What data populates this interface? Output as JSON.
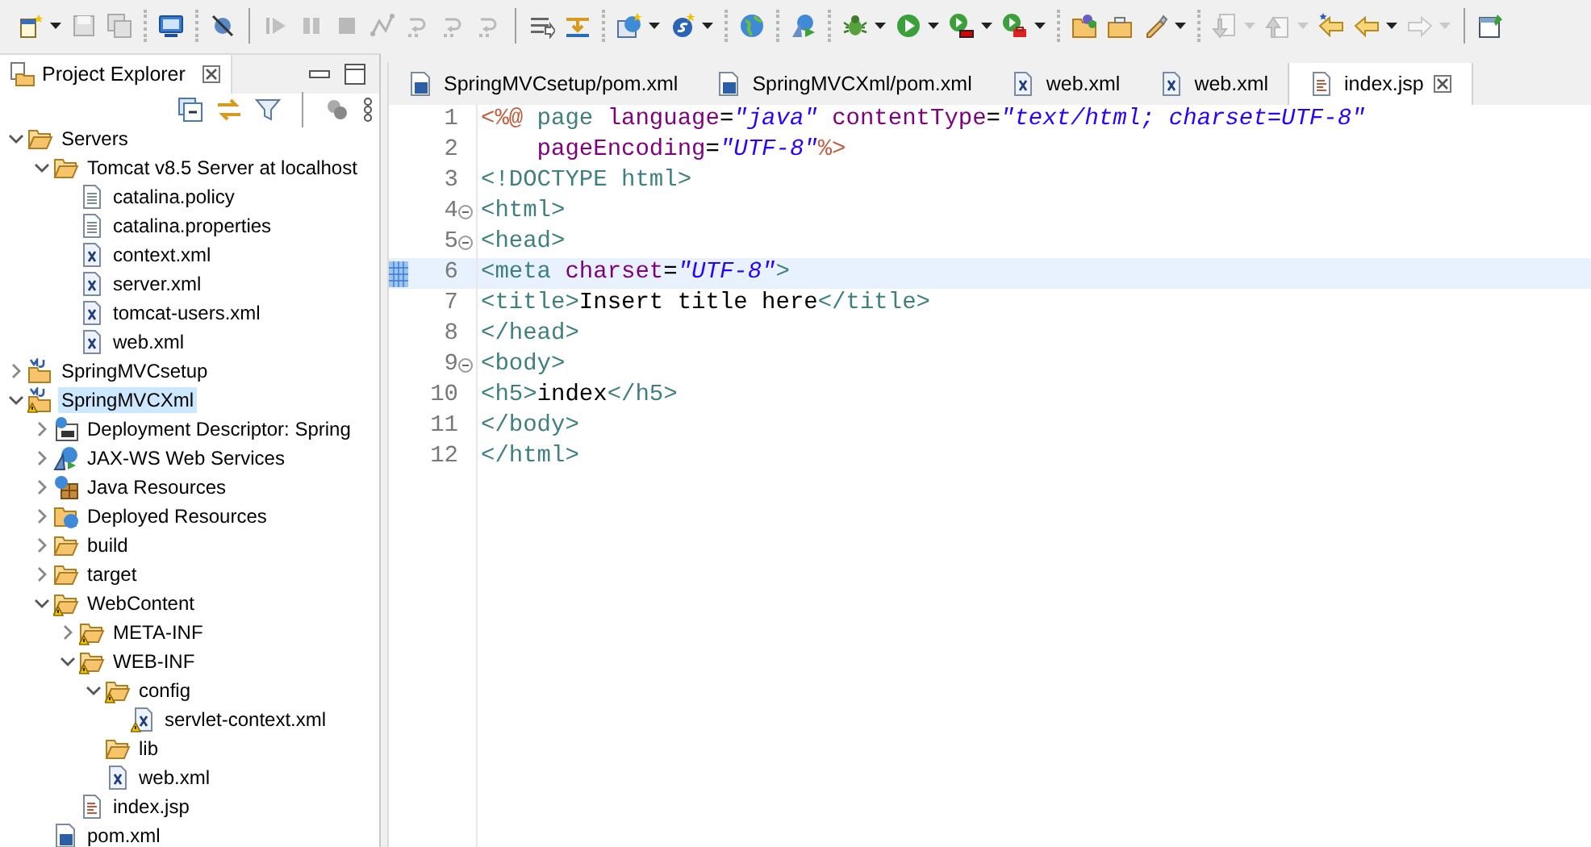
{
  "toolbar": [
    {
      "kind": "new",
      "disabled": false,
      "dropdown": true
    },
    {
      "kind": "save",
      "disabled": true,
      "dropdown": false
    },
    {
      "kind": "save-all",
      "disabled": true,
      "dropdown": false
    },
    {
      "kind": "grip"
    },
    {
      "kind": "monitor",
      "disabled": false,
      "dropdown": false
    },
    {
      "kind": "grip"
    },
    {
      "kind": "skip",
      "disabled": false,
      "dropdown": false
    },
    {
      "kind": "separator"
    },
    {
      "kind": "resume",
      "disabled": true,
      "dropdown": false
    },
    {
      "kind": "suspend",
      "disabled": true,
      "dropdown": false
    },
    {
      "kind": "stop",
      "disabled": true,
      "dropdown": false
    },
    {
      "kind": "disconnect",
      "disabled": true,
      "dropdown": false
    },
    {
      "kind": "step",
      "disabled": true,
      "dropdown": false
    },
    {
      "kind": "step",
      "disabled": true,
      "dropdown": false
    },
    {
      "kind": "step",
      "disabled": true,
      "dropdown": false
    },
    {
      "kind": "separator"
    },
    {
      "kind": "filter-lines",
      "disabled": false,
      "dropdown": false
    },
    {
      "kind": "drop-frame",
      "disabled": false,
      "dropdown": false
    },
    {
      "kind": "grip"
    },
    {
      "kind": "server",
      "disabled": false,
      "dropdown": true
    },
    {
      "kind": "spring",
      "disabled": false,
      "dropdown": true
    },
    {
      "kind": "grip"
    },
    {
      "kind": "globe",
      "disabled": false,
      "dropdown": false
    },
    {
      "kind": "grip"
    },
    {
      "kind": "web-service",
      "disabled": false,
      "dropdown": false
    },
    {
      "kind": "grip"
    },
    {
      "kind": "debug",
      "disabled": false,
      "dropdown": true
    },
    {
      "kind": "run",
      "disabled": false,
      "dropdown": true
    },
    {
      "kind": "run-ext",
      "disabled": false,
      "dropdown": true
    },
    {
      "kind": "run-tool",
      "disabled": false,
      "dropdown": true
    },
    {
      "kind": "grip"
    },
    {
      "kind": "open-type",
      "disabled": false,
      "dropdown": false
    },
    {
      "kind": "open-task",
      "disabled": false,
      "dropdown": false
    },
    {
      "kind": "pen",
      "disabled": false,
      "dropdown": true
    },
    {
      "kind": "grip"
    },
    {
      "kind": "next",
      "disabled": true,
      "dropdown": true
    },
    {
      "kind": "prev",
      "disabled": true,
      "dropdown": true
    },
    {
      "kind": "last-edit",
      "disabled": false,
      "dropdown": false
    },
    {
      "kind": "back",
      "disabled": false,
      "dropdown": true
    },
    {
      "kind": "forward",
      "disabled": true,
      "dropdown": true
    },
    {
      "kind": "separator"
    },
    {
      "kind": "window",
      "disabled": false,
      "dropdown": false
    }
  ],
  "explorer": {
    "title": "Project Explorer",
    "tree": [
      {
        "label": "Servers",
        "kind": "folder",
        "expanded": true,
        "selected": false,
        "warning": false,
        "children": [
          {
            "label": "Tomcat v8.5 Server at localhost",
            "kind": "folder",
            "expanded": true,
            "selected": false,
            "warning": false,
            "children": [
              {
                "label": "catalina.policy",
                "kind": "text-file",
                "selected": false,
                "warning": false
              },
              {
                "label": "catalina.properties",
                "kind": "text-file",
                "selected": false,
                "warning": false
              },
              {
                "label": "context.xml",
                "kind": "xml-file",
                "selected": false,
                "warning": false
              },
              {
                "label": "server.xml",
                "kind": "xml-file",
                "selected": false,
                "warning": false
              },
              {
                "label": "tomcat-users.xml",
                "kind": "xml-file",
                "selected": false,
                "warning": false
              },
              {
                "label": "web.xml",
                "kind": "xml-file",
                "selected": false,
                "warning": false
              }
            ]
          }
        ]
      },
      {
        "label": "SpringMVCsetup",
        "kind": "project",
        "expanded": false,
        "selected": false,
        "warning": false
      },
      {
        "label": "SpringMVCXml",
        "kind": "project",
        "expanded": true,
        "selected": true,
        "warning": true,
        "children": [
          {
            "label": "Deployment Descriptor: Spring",
            "kind": "descriptor",
            "expanded": false,
            "selected": false,
            "warning": false
          },
          {
            "label": "JAX-WS Web Services",
            "kind": "web-services",
            "expanded": false,
            "selected": false,
            "warning": false
          },
          {
            "label": "Java Resources",
            "kind": "java-resources",
            "expanded": false,
            "selected": false,
            "warning": false
          },
          {
            "label": "Deployed Resources",
            "kind": "deployed",
            "expanded": false,
            "selected": false,
            "warning": false
          },
          {
            "label": "build",
            "kind": "folder",
            "expanded": false,
            "selected": false,
            "warning": false
          },
          {
            "label": "target",
            "kind": "folder",
            "expanded": false,
            "selected": false,
            "warning": false
          },
          {
            "label": "WebContent",
            "kind": "folder",
            "expanded": true,
            "selected": false,
            "warning": true,
            "children": [
              {
                "label": "META-INF",
                "kind": "folder",
                "expanded": false,
                "selected": false,
                "warning": true
              },
              {
                "label": "WEB-INF",
                "kind": "folder",
                "expanded": true,
                "selected": false,
                "warning": true,
                "children": [
                  {
                    "label": "config",
                    "kind": "folder",
                    "expanded": true,
                    "selected": false,
                    "warning": true,
                    "children": [
                      {
                        "label": "servlet-context.xml",
                        "kind": "xml-file",
                        "selected": false,
                        "warning": true
                      }
                    ]
                  },
                  {
                    "label": "lib",
                    "kind": "folder",
                    "selected": false,
                    "warning": false
                  },
                  {
                    "label": "web.xml",
                    "kind": "xml-file",
                    "selected": false,
                    "warning": false
                  }
                ]
              },
              {
                "label": "index.jsp",
                "kind": "jsp-file",
                "selected": false,
                "warning": false
              }
            ]
          },
          {
            "label": "pom.xml",
            "kind": "maven-file",
            "selected": false,
            "warning": false
          }
        ]
      }
    ]
  },
  "editor": {
    "tabs": [
      {
        "label": "SpringMVCsetup/pom.xml",
        "kind": "maven-file",
        "selected": false
      },
      {
        "label": "SpringMVCXml/pom.xml",
        "kind": "maven-file",
        "selected": false
      },
      {
        "label": "web.xml",
        "kind": "xml-file",
        "selected": false
      },
      {
        "label": "web.xml",
        "kind": "xml-file",
        "selected": false
      },
      {
        "label": "index.jsp",
        "kind": "jsp-file",
        "selected": true
      }
    ],
    "lines": [
      {
        "number": "1",
        "fold": false,
        "current": false,
        "tokens": [
          {
            "kind": "jsp",
            "text": "<%@"
          },
          {
            "kind": "tag",
            "text": " page"
          },
          {
            "kind": "attr",
            "text": " language"
          },
          {
            "kind": "plain",
            "text": "="
          },
          {
            "kind": "value",
            "text": "\"java\""
          },
          {
            "kind": "attr",
            "text": " contentType"
          },
          {
            "kind": "plain",
            "text": "="
          },
          {
            "kind": "value",
            "text": "\"text/html; charset=UTF-8\""
          }
        ]
      },
      {
        "number": "2",
        "fold": false,
        "current": false,
        "tokens": [
          {
            "kind": "attr",
            "text": "    pageEncoding"
          },
          {
            "kind": "plain",
            "text": "="
          },
          {
            "kind": "value",
            "text": "\"UTF-8\""
          },
          {
            "kind": "jsp",
            "text": "%>"
          }
        ]
      },
      {
        "number": "3",
        "fold": false,
        "current": false,
        "tokens": [
          {
            "kind": "tag",
            "text": "<!DOCTYPE html>"
          }
        ]
      },
      {
        "number": "4",
        "fold": true,
        "current": false,
        "tokens": [
          {
            "kind": "tag",
            "text": "<html>"
          }
        ]
      },
      {
        "number": "5",
        "fold": true,
        "current": false,
        "tokens": [
          {
            "kind": "tag",
            "text": "<head>"
          }
        ]
      },
      {
        "number": "6",
        "fold": false,
        "current": true,
        "tokens": [
          {
            "kind": "tag",
            "text": "<meta"
          },
          {
            "kind": "attr",
            "text": " charset"
          },
          {
            "kind": "plain",
            "text": "="
          },
          {
            "kind": "value",
            "text": "\"UTF-8\""
          },
          {
            "kind": "tag",
            "text": ">"
          }
        ]
      },
      {
        "number": "7",
        "fold": false,
        "current": false,
        "tokens": [
          {
            "kind": "tag",
            "text": "<title>"
          },
          {
            "kind": "text",
            "text": "Insert title here"
          },
          {
            "kind": "tag",
            "text": "</title>"
          }
        ]
      },
      {
        "number": "8",
        "fold": false,
        "current": false,
        "tokens": [
          {
            "kind": "tag",
            "text": "</head>"
          }
        ]
      },
      {
        "number": "9",
        "fold": true,
        "current": false,
        "tokens": [
          {
            "kind": "tag",
            "text": "<body>"
          }
        ]
      },
      {
        "number": "10",
        "fold": false,
        "current": false,
        "tokens": [
          {
            "kind": "tag",
            "text": "<h5>"
          },
          {
            "kind": "text",
            "text": "index"
          },
          {
            "kind": "tag",
            "text": "</h5>"
          }
        ]
      },
      {
        "number": "11",
        "fold": false,
        "current": false,
        "tokens": [
          {
            "kind": "tag",
            "text": "</body>"
          }
        ]
      },
      {
        "number": "12",
        "fold": false,
        "current": false,
        "tokens": [
          {
            "kind": "tag",
            "text": "</html>"
          }
        ]
      }
    ]
  }
}
